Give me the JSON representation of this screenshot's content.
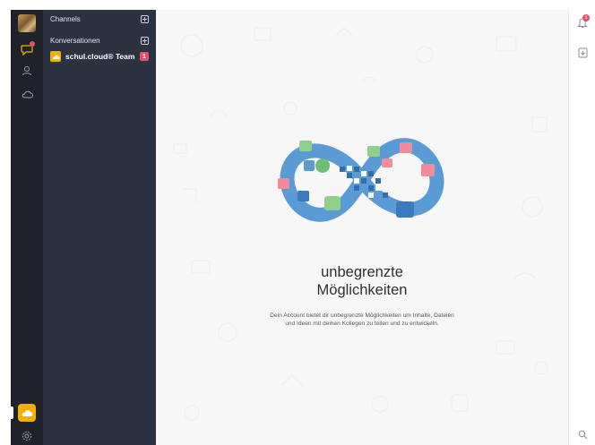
{
  "sidebar": {
    "channels_label": "Channels",
    "conversations_label": "Konversationen",
    "items": [
      {
        "label": "schul.cloud® Team",
        "badge": "1"
      }
    ]
  },
  "main": {
    "title_line1": "unbegrenzte",
    "title_line2": "Möglichkeiten",
    "description": "Dein Account bietet dir unbegrenzte Möglichkeiten um Inhalte, Dateien und Ideen mit deinen Kollegen zu teilen und zu entwickeln."
  },
  "rightbar": {
    "notification_badge": "1"
  },
  "icons": {
    "rail": [
      "profile-avatar",
      "chat-bubble-icon",
      "user-icon",
      "cloud-icon",
      "team-icon",
      "gear-icon"
    ],
    "right": [
      "bell-icon",
      "file-icon",
      "search-icon"
    ]
  },
  "colors": {
    "rail_bg": "#1f2329",
    "sidebar_bg": "#2c3340",
    "accent_yellow": "#f4b000",
    "badge_red": "#ee4b6a",
    "infinity_blue": "#5b9bd5"
  }
}
